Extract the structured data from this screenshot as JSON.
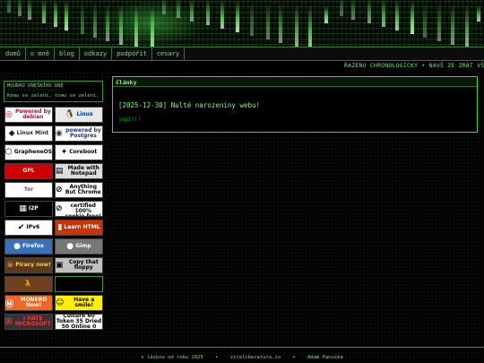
{
  "nav": [
    "domů",
    "o mně",
    "blog",
    "odkazy",
    "podpořit",
    "cesary"
  ],
  "ticker": "ŘAZENO CHRONOLOGICKY • NAVŠ ZE ZRÁT VŠE",
  "sidebar": {
    "title": "MOUDRO DNEŠNÍHO DNE",
    "separator": "-------------------",
    "quote": "Kému se zelení, tomu se zelení."
  },
  "badges": [
    {
      "name": "debian-badge",
      "text": "Powered by debian",
      "icon": "debian-icon",
      "bg": "#ffffff",
      "fg": "#c70036"
    },
    {
      "name": "linux-badge",
      "text": "Linux",
      "icon": "penguin-icon",
      "bg": "#e8e8e8",
      "fg": "#003399"
    },
    {
      "name": "linux-mint-badge",
      "text": "Linux Mint",
      "icon": "mint-icon",
      "bg": "#ffffff",
      "fg": "#222222"
    },
    {
      "name": "postgres-badge",
      "text": "powered by Postgres",
      "icon": "elephant-icon",
      "bg": "#ffffff",
      "fg": "#223366"
    },
    {
      "name": "grapheneos-badge",
      "text": "GrapheneOS",
      "icon": "hexagon-icon",
      "bg": "#ffffff",
      "fg": "#000000"
    },
    {
      "name": "coreboot-badge",
      "text": "Coreboot",
      "icon": "rabbit-icon",
      "bg": "#ffffff",
      "fg": "#000000"
    },
    {
      "name": "gpl-badge",
      "text": "GPL",
      "icon": "gpl-icon",
      "bg": "#cc0000",
      "fg": "#ffffff"
    },
    {
      "name": "notepad-badge",
      "text": "Made with Notepad",
      "icon": "notepad-icon",
      "bg": "#dddddd",
      "fg": "#000000"
    },
    {
      "name": "tor-badge",
      "text": "Tor",
      "icon": "onion-icon",
      "bg": "#ffffff",
      "fg": "#7d4698"
    },
    {
      "name": "no-chrome-badge",
      "text": "Anything But Chrome",
      "icon": "no-icon",
      "bg": "#ffffff",
      "fg": "#000000"
    },
    {
      "name": "i2p-badge",
      "text": "I2P",
      "icon": "grid-icon",
      "bg": "#000000",
      "fg": "#ffffff"
    },
    {
      "name": "cookie-free-badge",
      "text": "This site is certified 100% cookie free!",
      "icon": "no-cookie-icon",
      "bg": "#ffffff",
      "fg": "#000000"
    },
    {
      "name": "ipv6-badge",
      "text": "IPv6",
      "icon": "check-icon",
      "bg": "#ffffff",
      "fg": "#000000"
    },
    {
      "name": "learn-html-badge",
      "text": "Learn HTML",
      "icon": "learn-icon",
      "bg": "#cc3300",
      "fg": "#ffffff"
    },
    {
      "name": "firefox-badge",
      "text": "Firefox",
      "icon": "firefox-icon",
      "bg": "#3a70b8",
      "fg": "#ffffff"
    },
    {
      "name": "gimp-badge",
      "text": "Gimp",
      "icon": "gimp-icon",
      "bg": "#777777",
      "fg": "#ffffff"
    },
    {
      "name": "piracy-badge",
      "text": "Piracy now!",
      "icon": "pirate-icon",
      "bg": "#5a3a1a",
      "fg": "#ffcc66"
    },
    {
      "name": "copy-badge",
      "text": "Copy that floppy",
      "icon": "floppy-icon",
      "bg": "#c0c0c0",
      "fg": "#000000"
    },
    {
      "name": "half-life-badge",
      "text": "",
      "icon": "lambda-icon",
      "bg": "#704020",
      "fg": "#ffaa00"
    },
    {
      "name": "empty-badge",
      "text": "",
      "icon": "",
      "bg": "#000000",
      "fg": "#33ff33"
    },
    {
      "name": "monero-badge",
      "text": "MONERO Now!",
      "icon": "monero-icon",
      "bg": "#f26822",
      "fg": "#ffffff"
    },
    {
      "name": "smile-badge",
      "text": "Have a smile!",
      "icon": "smiley-icon",
      "bg": "#ffee00",
      "fg": "#000000"
    },
    {
      "name": "hate-microsoft-badge",
      "text": "I HATE MICROSOFT",
      "icon": "windows-icon",
      "bg": "#333333",
      "fg": "#ff3333"
    },
    {
      "name": "stats-badge",
      "text": "Culture 60 Token 35 Dried 50 Online 0",
      "icon": "",
      "bg": "#ffffff",
      "fg": "#000000"
    }
  ],
  "main": {
    "section_title": "články",
    "post_title": "[2025-12-30] Nulté narozeniny webu!",
    "post_body": "jupí!!!"
  },
  "footer": {
    "copyright": "s láskou od roku 2025",
    "email": "vitaliberatuta.io",
    "author": "Adam Panuška",
    "sep": "•"
  },
  "colors": {
    "accent": "#33ff33",
    "border": "#2f9a2f",
    "background": "#000000"
  }
}
